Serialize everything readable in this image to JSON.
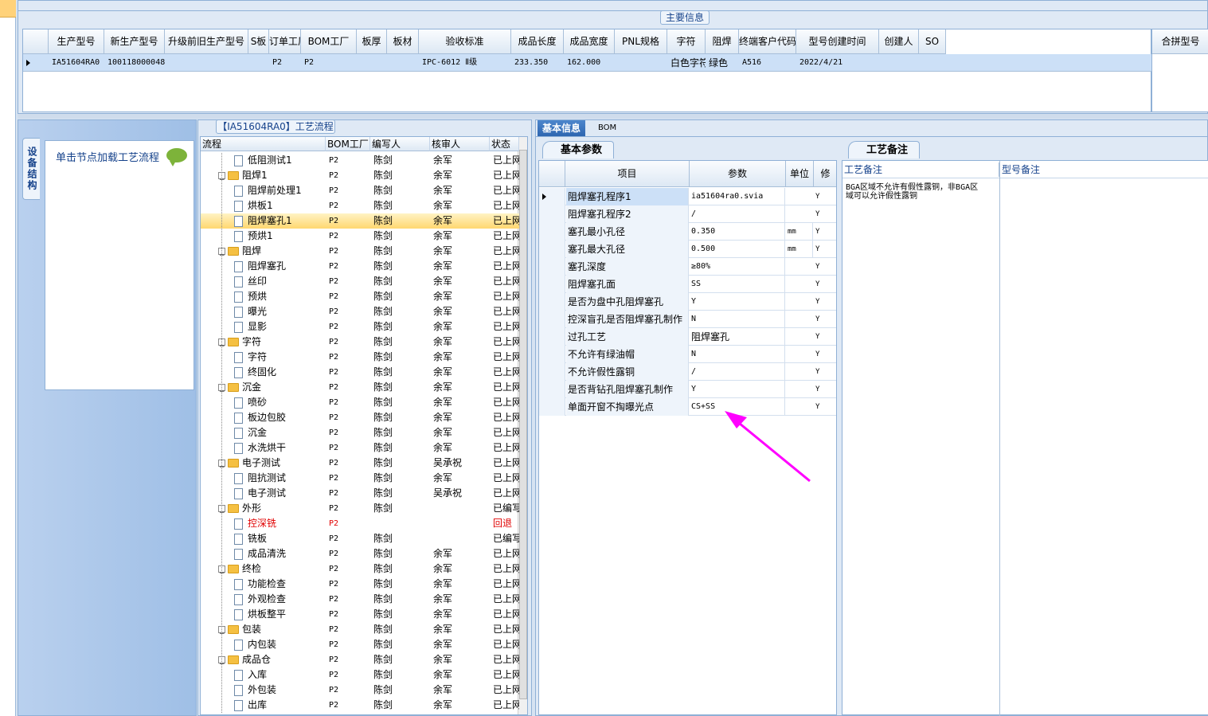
{
  "main_section_title": "主要信息",
  "main_columns": [
    "生产型号",
    "新生产型号",
    "升级前旧生产型号",
    "S板",
    "订单工厂",
    "BOM工厂",
    "板厚",
    "板材",
    "验收标准",
    "成品长度",
    "成品宽度",
    "PNL规格",
    "字符",
    "阻焊",
    "终端客户代码",
    "型号创建时间",
    "创建人",
    "SO"
  ],
  "extra_column": "合拼型号",
  "main_row": [
    "IA51604RA0",
    "10011800004814",
    "",
    "",
    "P2",
    "P2",
    "",
    "",
    "IPC-6012 Ⅱ级",
    "233.350",
    "162.000",
    "",
    "白色字符",
    "绿色",
    "A516",
    "2022/4/21",
    "",
    ""
  ],
  "device_tab": "设备结构",
  "device_hint": "单击节点加载工艺流程",
  "process_title": "【IA51604RA0】工艺流程",
  "tree_columns": [
    "流程",
    "BOM工厂",
    "编写人",
    "核审人",
    "状态"
  ],
  "tree_rows": [
    {
      "name": "低阻测试1",
      "level": 2,
      "type": "doc",
      "bom": "P2",
      "author": "陈剑",
      "reviewer": "余军",
      "status": "已上网"
    },
    {
      "name": "阻焊1",
      "level": 1,
      "type": "folder",
      "bom": "P2",
      "author": "陈剑",
      "reviewer": "余军",
      "status": "已上网"
    },
    {
      "name": "阻焊前处理1",
      "level": 2,
      "type": "doc",
      "bom": "P2",
      "author": "陈剑",
      "reviewer": "余军",
      "status": "已上网"
    },
    {
      "name": "烘板1",
      "level": 2,
      "type": "doc",
      "bom": "P2",
      "author": "陈剑",
      "reviewer": "余军",
      "status": "已上网"
    },
    {
      "name": "阻焊塞孔1",
      "level": 2,
      "type": "doc",
      "bom": "P2",
      "author": "陈剑",
      "reviewer": "余军",
      "status": "已上网",
      "selected": true
    },
    {
      "name": "预烘1",
      "level": 2,
      "type": "doc",
      "bom": "P2",
      "author": "陈剑",
      "reviewer": "余军",
      "status": "已上网"
    },
    {
      "name": "阻焊",
      "level": 1,
      "type": "folder",
      "bom": "P2",
      "author": "陈剑",
      "reviewer": "余军",
      "status": "已上网"
    },
    {
      "name": "阻焊塞孔",
      "level": 2,
      "type": "doc",
      "bom": "P2",
      "author": "陈剑",
      "reviewer": "余军",
      "status": "已上网"
    },
    {
      "name": "丝印",
      "level": 2,
      "type": "doc",
      "bom": "P2",
      "author": "陈剑",
      "reviewer": "余军",
      "status": "已上网"
    },
    {
      "name": "预烘",
      "level": 2,
      "type": "doc",
      "bom": "P2",
      "author": "陈剑",
      "reviewer": "余军",
      "status": "已上网"
    },
    {
      "name": "曝光",
      "level": 2,
      "type": "doc",
      "bom": "P2",
      "author": "陈剑",
      "reviewer": "余军",
      "status": "已上网"
    },
    {
      "name": "显影",
      "level": 2,
      "type": "doc",
      "bom": "P2",
      "author": "陈剑",
      "reviewer": "余军",
      "status": "已上网"
    },
    {
      "name": "字符",
      "level": 1,
      "type": "folder",
      "bom": "P2",
      "author": "陈剑",
      "reviewer": "余军",
      "status": "已上网"
    },
    {
      "name": "字符",
      "level": 2,
      "type": "doc",
      "bom": "P2",
      "author": "陈剑",
      "reviewer": "余军",
      "status": "已上网"
    },
    {
      "name": "终固化",
      "level": 2,
      "type": "doc",
      "bom": "P2",
      "author": "陈剑",
      "reviewer": "余军",
      "status": "已上网"
    },
    {
      "name": "沉金",
      "level": 1,
      "type": "folder",
      "bom": "P2",
      "author": "陈剑",
      "reviewer": "余军",
      "status": "已上网"
    },
    {
      "name": "喷砂",
      "level": 2,
      "type": "doc",
      "bom": "P2",
      "author": "陈剑",
      "reviewer": "余军",
      "status": "已上网"
    },
    {
      "name": "板边包胶",
      "level": 2,
      "type": "doc",
      "bom": "P2",
      "author": "陈剑",
      "reviewer": "余军",
      "status": "已上网"
    },
    {
      "name": "沉金",
      "level": 2,
      "type": "doc",
      "bom": "P2",
      "author": "陈剑",
      "reviewer": "余军",
      "status": "已上网"
    },
    {
      "name": "水洗烘干",
      "level": 2,
      "type": "doc",
      "bom": "P2",
      "author": "陈剑",
      "reviewer": "余军",
      "status": "已上网"
    },
    {
      "name": "电子测试",
      "level": 1,
      "type": "folder",
      "bom": "P2",
      "author": "陈剑",
      "reviewer": "吴承祝",
      "status": "已上网"
    },
    {
      "name": "阻抗测试",
      "level": 2,
      "type": "doc",
      "bom": "P2",
      "author": "陈剑",
      "reviewer": "余军",
      "status": "已上网"
    },
    {
      "name": "电子测试",
      "level": 2,
      "type": "doc",
      "bom": "P2",
      "author": "陈剑",
      "reviewer": "吴承祝",
      "status": "已上网"
    },
    {
      "name": "外形",
      "level": 1,
      "type": "folder",
      "bom": "P2",
      "author": "陈剑",
      "reviewer": "",
      "status": "已编写"
    },
    {
      "name": "控深铣",
      "level": 2,
      "type": "doc",
      "bom": "P2",
      "author": "",
      "reviewer": "",
      "status": "回退",
      "red": true
    },
    {
      "name": "铣板",
      "level": 2,
      "type": "doc",
      "bom": "P2",
      "author": "陈剑",
      "reviewer": "",
      "status": "已编写"
    },
    {
      "name": "成品清洗",
      "level": 2,
      "type": "doc",
      "bom": "P2",
      "author": "陈剑",
      "reviewer": "余军",
      "status": "已上网"
    },
    {
      "name": "终检",
      "level": 1,
      "type": "folder",
      "bom": "P2",
      "author": "陈剑",
      "reviewer": "余军",
      "status": "已上网"
    },
    {
      "name": "功能检查",
      "level": 2,
      "type": "doc",
      "bom": "P2",
      "author": "陈剑",
      "reviewer": "余军",
      "status": "已上网"
    },
    {
      "name": "外观检查",
      "level": 2,
      "type": "doc",
      "bom": "P2",
      "author": "陈剑",
      "reviewer": "余军",
      "status": "已上网"
    },
    {
      "name": "烘板整平",
      "level": 2,
      "type": "doc",
      "bom": "P2",
      "author": "陈剑",
      "reviewer": "余军",
      "status": "已上网"
    },
    {
      "name": "包装",
      "level": 1,
      "type": "folder",
      "bom": "P2",
      "author": "陈剑",
      "reviewer": "余军",
      "status": "已上网"
    },
    {
      "name": "内包装",
      "level": 2,
      "type": "doc",
      "bom": "P2",
      "author": "陈剑",
      "reviewer": "余军",
      "status": "已上网"
    },
    {
      "name": "成品仓",
      "level": 1,
      "type": "folder",
      "bom": "P2",
      "author": "陈剑",
      "reviewer": "余军",
      "status": "已上网"
    },
    {
      "name": "入库",
      "level": 2,
      "type": "doc",
      "bom": "P2",
      "author": "陈剑",
      "reviewer": "余军",
      "status": "已上网"
    },
    {
      "name": "外包装",
      "level": 2,
      "type": "doc",
      "bom": "P2",
      "author": "陈剑",
      "reviewer": "余军",
      "status": "已上网"
    },
    {
      "name": "出库",
      "level": 2,
      "type": "doc",
      "bom": "P2",
      "author": "陈剑",
      "reviewer": "余军",
      "status": "已上网"
    }
  ],
  "detail_tabs": [
    "基本信息",
    "BOM"
  ],
  "params_tab": "基本参数",
  "param_columns": [
    "项目",
    "参数",
    "单位",
    "修"
  ],
  "params": [
    {
      "item": "阻焊塞孔程序1",
      "value": "ia51604ra0.svia",
      "unit": "",
      "mod": "Y"
    },
    {
      "item": "阻焊塞孔程序2",
      "value": "/",
      "unit": "",
      "mod": "Y"
    },
    {
      "item": "塞孔最小孔径",
      "value": "0.350",
      "unit": "mm",
      "mod": "Y"
    },
    {
      "item": "塞孔最大孔径",
      "value": "0.500",
      "unit": "mm",
      "mod": "Y"
    },
    {
      "item": "塞孔深度",
      "value": "≥80%",
      "unit": "",
      "mod": "Y"
    },
    {
      "item": "阻焊塞孔面",
      "value": "SS",
      "unit": "",
      "mod": "Y"
    },
    {
      "item": "是否为盘中孔阻焊塞孔",
      "value": "Y",
      "unit": "",
      "mod": "Y"
    },
    {
      "item": "控深盲孔是否阻焊塞孔制作",
      "value": "N",
      "unit": "",
      "mod": "Y"
    },
    {
      "item": "过孔工艺",
      "value": "阻焊塞孔",
      "unit": "",
      "mod": "Y"
    },
    {
      "item": "不允许有绿油帽",
      "value": "N",
      "unit": "",
      "mod": "Y"
    },
    {
      "item": "不允许假性露铜",
      "value": "/",
      "unit": "",
      "mod": "Y"
    },
    {
      "item": "是否背钻孔阻焊塞孔制作",
      "value": "Y",
      "unit": "",
      "mod": "Y"
    },
    {
      "item": "单面开窗不掏曝光点",
      "value": "CS+SS",
      "unit": "",
      "mod": "Y"
    }
  ],
  "notes_tab": "工艺备注",
  "notes_col1": "工艺备注",
  "notes_col2": "型号备注",
  "notes_text": "BGA区域不允许有假性露铜，非BGA区域可以允许假性露铜",
  "annotation_color": "#ff00ff"
}
